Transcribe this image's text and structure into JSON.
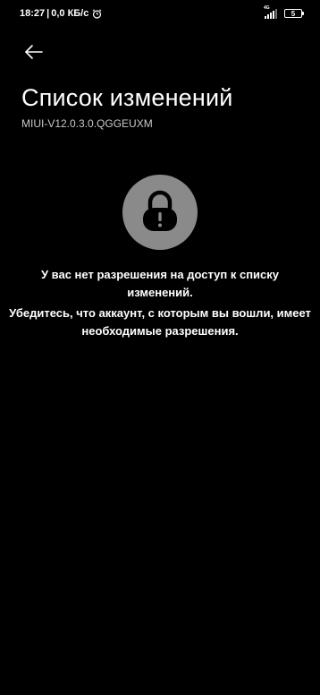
{
  "status_bar": {
    "time": "18:27",
    "separator": "|",
    "data_speed": "0,0 КБ/с",
    "network_label": "4G",
    "battery_level": "5"
  },
  "header": {
    "title": "Список изменений",
    "subtitle": "MIUI-V12.0.3.0.QGGEUXM"
  },
  "main": {
    "message_primary": "У вас нет разрешения на доступ к списку изменений.",
    "message_secondary": "Убедитесь, что аккаунт, с которым вы вошли, имеет необходимые разрешения."
  },
  "colors": {
    "background": "#000000",
    "text": "#ffffff",
    "subtitle": "#c8c8c8",
    "lock_circle": "#8a8a8a",
    "lock_glyph": "#000000"
  },
  "icons": {
    "back": "arrow-left-icon",
    "alarm": "alarm-clock-icon",
    "signal": "signal-icon",
    "battery": "battery-icon",
    "lock": "lock-icon"
  }
}
